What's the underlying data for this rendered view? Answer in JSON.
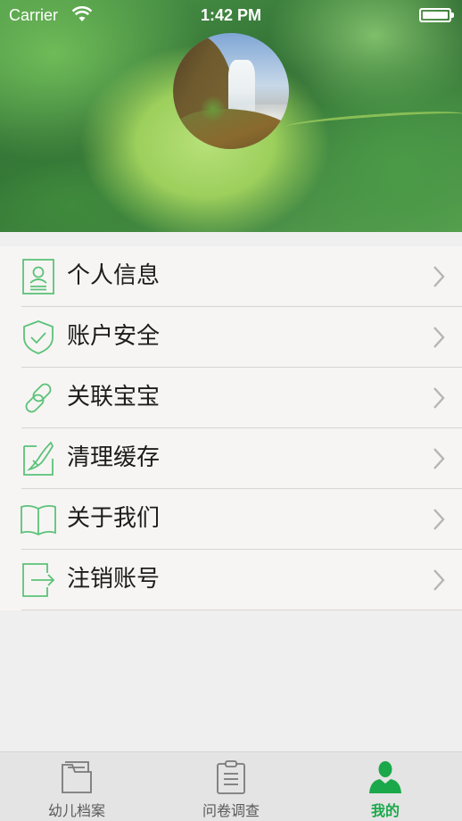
{
  "status_bar": {
    "carrier": "Carrier",
    "time": "1:42 PM"
  },
  "profile": {
    "avatar": "waterfall-landscape-photo"
  },
  "menu": {
    "items": [
      {
        "label": "个人信息",
        "icon": "id-card-icon"
      },
      {
        "label": "账户安全",
        "icon": "shield-check-icon"
      },
      {
        "label": "关联宝宝",
        "icon": "link-icon"
      },
      {
        "label": "清理缓存",
        "icon": "clean-cache-icon"
      },
      {
        "label": "关于我们",
        "icon": "book-icon"
      },
      {
        "label": "注销账号",
        "icon": "logout-icon"
      }
    ]
  },
  "tab_bar": {
    "tabs": [
      {
        "label": "幼儿档案",
        "icon": "folder-icon",
        "active": false
      },
      {
        "label": "问卷调查",
        "icon": "clipboard-icon",
        "active": false
      },
      {
        "label": "我的",
        "icon": "person-icon",
        "active": true
      }
    ]
  },
  "colors": {
    "accent": "#1ba84a",
    "icon_outline": "#5cc27a"
  }
}
